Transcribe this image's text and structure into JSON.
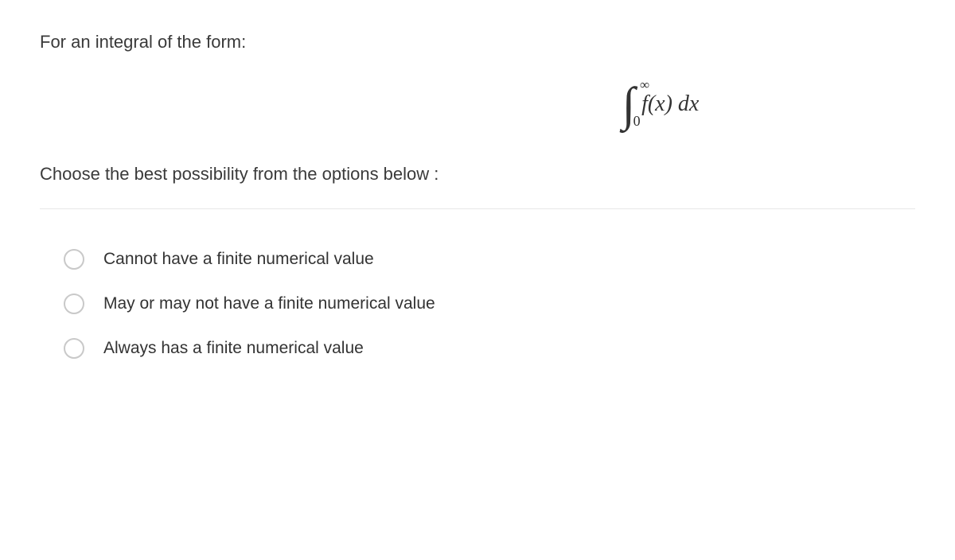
{
  "question": {
    "intro": "For an integral of the form:",
    "instruction": "Choose the best possibility from the options below :"
  },
  "formula": {
    "upper_limit": "∞",
    "lower_limit": "0",
    "integrand": "f(x) dx"
  },
  "options": [
    {
      "label": "Cannot have a finite numerical value"
    },
    {
      "label": "May or may not have a finite numerical value"
    },
    {
      "label": "Always has a finite numerical value"
    }
  ]
}
